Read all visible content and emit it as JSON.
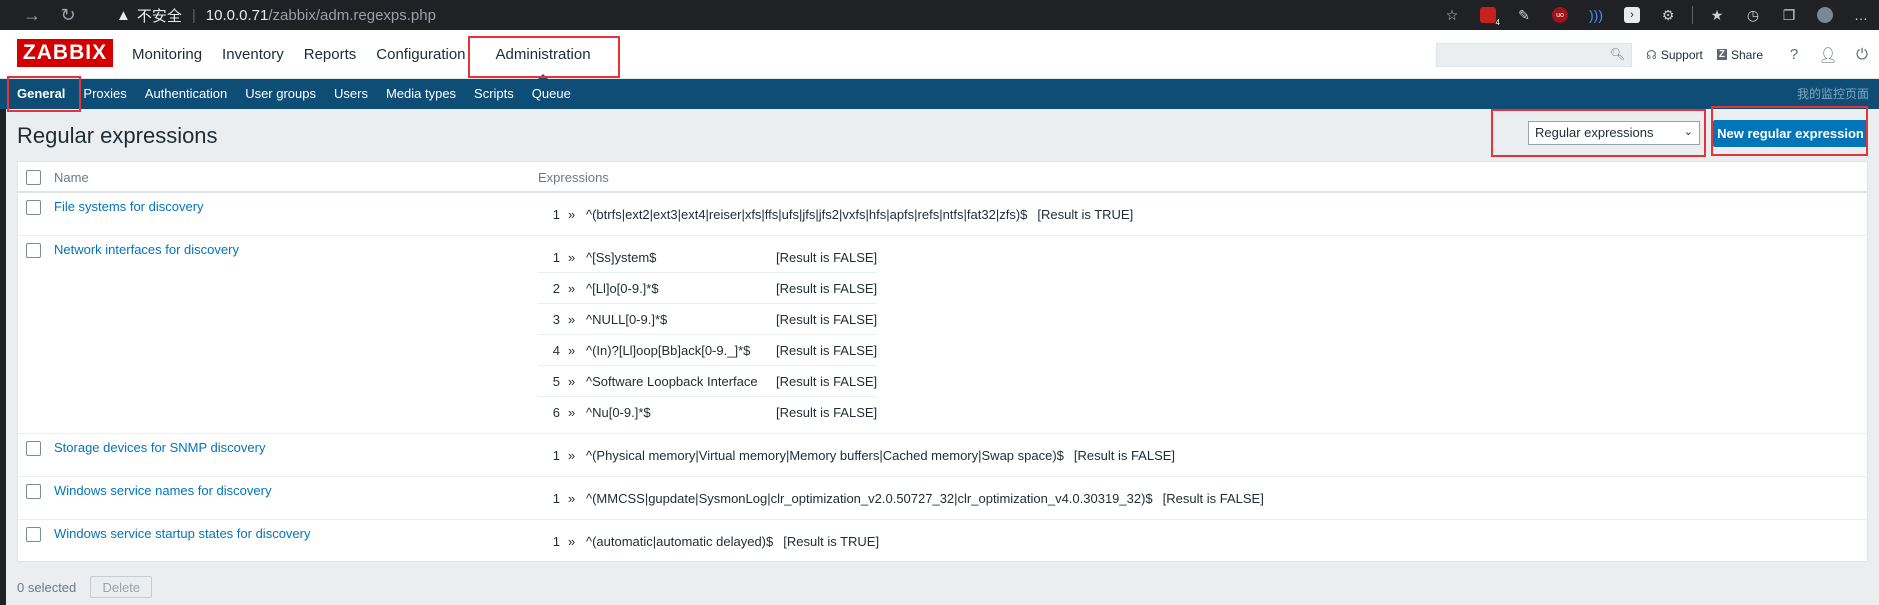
{
  "browser": {
    "security_label": "不安全",
    "url_host": "10.0.0.71",
    "url_path": "/zabbix/adm.regexps.php",
    "badge_count": "4",
    "ext_labels": [
      "uo"
    ]
  },
  "zabbix": {
    "logo": "ZABBIX",
    "top_menu": [
      "Monitoring",
      "Inventory",
      "Reports",
      "Configuration",
      "Administration"
    ],
    "search_placeholder": "",
    "support_label": "Support",
    "share_label": "Share",
    "help_label": "?",
    "sub_menu": [
      "General",
      "Proxies",
      "Authentication",
      "User groups",
      "Users",
      "Media types",
      "Scripts",
      "Queue"
    ],
    "sub_right_text": "我的监控页面"
  },
  "page": {
    "title": "Regular expressions",
    "select_value": "Regular expressions",
    "new_button": "New regular expression"
  },
  "table": {
    "col_name": "Name",
    "col_expressions": "Expressions",
    "rows": [
      {
        "name": "File systems for discovery",
        "expressions": [
          {
            "n": "1",
            "arrow": "»",
            "rx": "^(btrfs|ext2|ext3|ext4|reiser|xfs|ffs|ufs|jfs|jfs2|vxfs|hfs|apfs|refs|ntfs|fat32|zfs)$",
            "result": "[Result is TRUE]"
          }
        ]
      },
      {
        "name": "Network interfaces for discovery",
        "expressions": [
          {
            "n": "1",
            "arrow": "»",
            "rx": "^[Ss]ystem$",
            "result": "[Result is FALSE]"
          },
          {
            "n": "2",
            "arrow": "»",
            "rx": "^[Ll]o[0-9.]*$",
            "result": "[Result is FALSE]"
          },
          {
            "n": "3",
            "arrow": "»",
            "rx": "^NULL[0-9.]*$",
            "result": "[Result is FALSE]"
          },
          {
            "n": "4",
            "arrow": "»",
            "rx": "^(In)?[Ll]oop[Bb]ack[0-9._]*$",
            "result": "[Result is FALSE]"
          },
          {
            "n": "5",
            "arrow": "»",
            "rx": "^Software Loopback Interface",
            "result": "[Result is FALSE]"
          },
          {
            "n": "6",
            "arrow": "»",
            "rx": "^Nu[0-9.]*$",
            "result": "[Result is FALSE]"
          }
        ]
      },
      {
        "name": "Storage devices for SNMP discovery",
        "expressions": [
          {
            "n": "1",
            "arrow": "»",
            "rx": "^(Physical memory|Virtual memory|Memory buffers|Cached memory|Swap space)$",
            "result": "[Result is FALSE]"
          }
        ]
      },
      {
        "name": "Windows service names for discovery",
        "expressions": [
          {
            "n": "1",
            "arrow": "»",
            "rx": "^(MMCSS|gupdate|SysmonLog|clr_optimization_v2.0.50727_32|clr_optimization_v4.0.30319_32)$",
            "result": "[Result is FALSE]"
          }
        ]
      },
      {
        "name": "Windows service startup states for discovery",
        "expressions": [
          {
            "n": "1",
            "arrow": "»",
            "rx": "^(automatic|automatic delayed)$",
            "result": "[Result is TRUE]"
          }
        ]
      }
    ]
  },
  "footer": {
    "selected_text": "0 selected",
    "delete_label": "Delete"
  },
  "colors": {
    "brand_red": "#d40000",
    "nav_blue": "#0e4d75",
    "button_blue": "#0275b8",
    "highlight_red": "#e63338"
  }
}
